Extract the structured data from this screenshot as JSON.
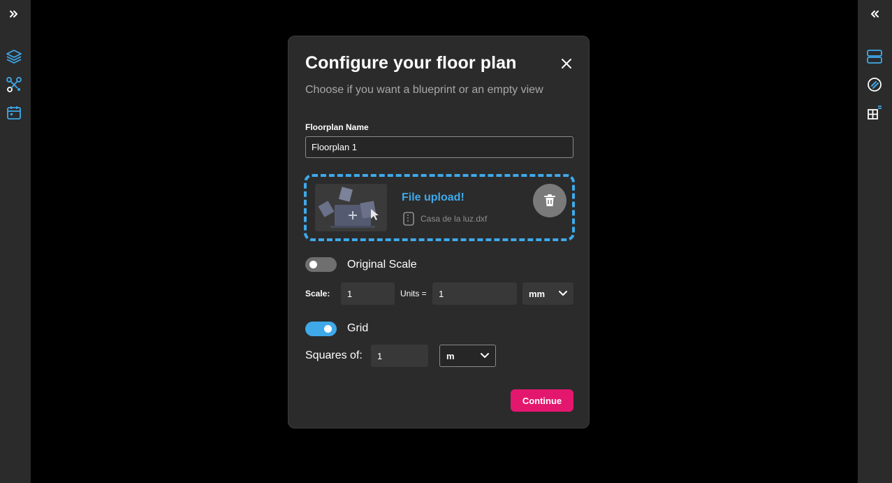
{
  "colors": {
    "accent_blue": "#3fa9ea",
    "primary_pink": "#e4176e",
    "panel": "#2b2b2b",
    "backdrop": "#000000"
  },
  "left_rail": {
    "items": [
      {
        "icon": "expand-chevrons-icon"
      },
      {
        "icon": "layers-icon"
      },
      {
        "icon": "connections-icon"
      },
      {
        "icon": "calendar-icon"
      }
    ]
  },
  "right_rail": {
    "items": [
      {
        "icon": "collapse-chevrons-icon"
      },
      {
        "icon": "server-rack-icon"
      },
      {
        "icon": "link-icon"
      },
      {
        "icon": "floorplan-settings-icon"
      }
    ]
  },
  "modal": {
    "title": "Configure your floor plan",
    "subtitle": "Choose if you want a blueprint or an empty view",
    "name_field": {
      "label": "Floorplan Name",
      "value": "Floorplan 1"
    },
    "upload": {
      "title": "File upload!",
      "file_name": "Casa de la luz.dxf",
      "thumb_icon": "upload-illustration-icon",
      "delete_icon": "trash-icon"
    },
    "original_scale": {
      "label": "Original Scale",
      "enabled": false
    },
    "scale": {
      "label": "Scale:",
      "value": "1",
      "units_label": "Units =",
      "units_value": "1",
      "unit": "mm"
    },
    "grid": {
      "label": "Grid",
      "enabled": true,
      "squares_label": "Squares of:",
      "squares_value": "1",
      "unit": "m"
    },
    "continue_label": "Continue"
  }
}
